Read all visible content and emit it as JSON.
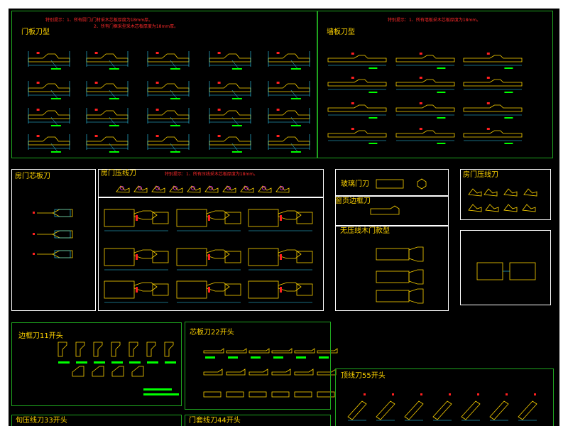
{
  "colors": {
    "background": "#000000",
    "frame": "#ffffff",
    "frame_green": "#1fa51f",
    "title": "#ffd400",
    "note": "#ff2a2a",
    "profile": "#ffd400",
    "dim": "#2fd6ff",
    "tag": "#00ff00",
    "marker": "#ff2020",
    "cut": "#ff3cff"
  },
  "top_section": {
    "note_left_1": "特别提示：1、所有厨门/门材采木芯板厚度为18mm厚。",
    "note_left_2": "2、所有门框采型采木芯板厚度为18mm厚。",
    "note_right": "特别提示：1、所有墙板采木芯板厚度为18mm。",
    "door_panel_title": "门板刀型",
    "wall_panel_title": "墙板刀型"
  },
  "middle_section": {
    "core_board_title": "房门芯板刀",
    "press_line_title": "房门压线刀",
    "press_line_note": "特别提示：1、所有压线采木芯板厚度为18mm。",
    "glass_door_title": "玻璃门刀",
    "window_frame_title": "窗页边框刀",
    "no_press_door_title": "无压线木门款型",
    "press_line_right_title": "房门压线刀"
  },
  "bottom_section": {
    "edge_frame_title": "边框刀11开头",
    "core_board_22_title": "芯板刀22开头",
    "top_line_55_title": "顶线刀55开头",
    "hook_press_33_title": "旬压线刀33开头",
    "door_cover_44_title": "门套线刀44开头"
  }
}
